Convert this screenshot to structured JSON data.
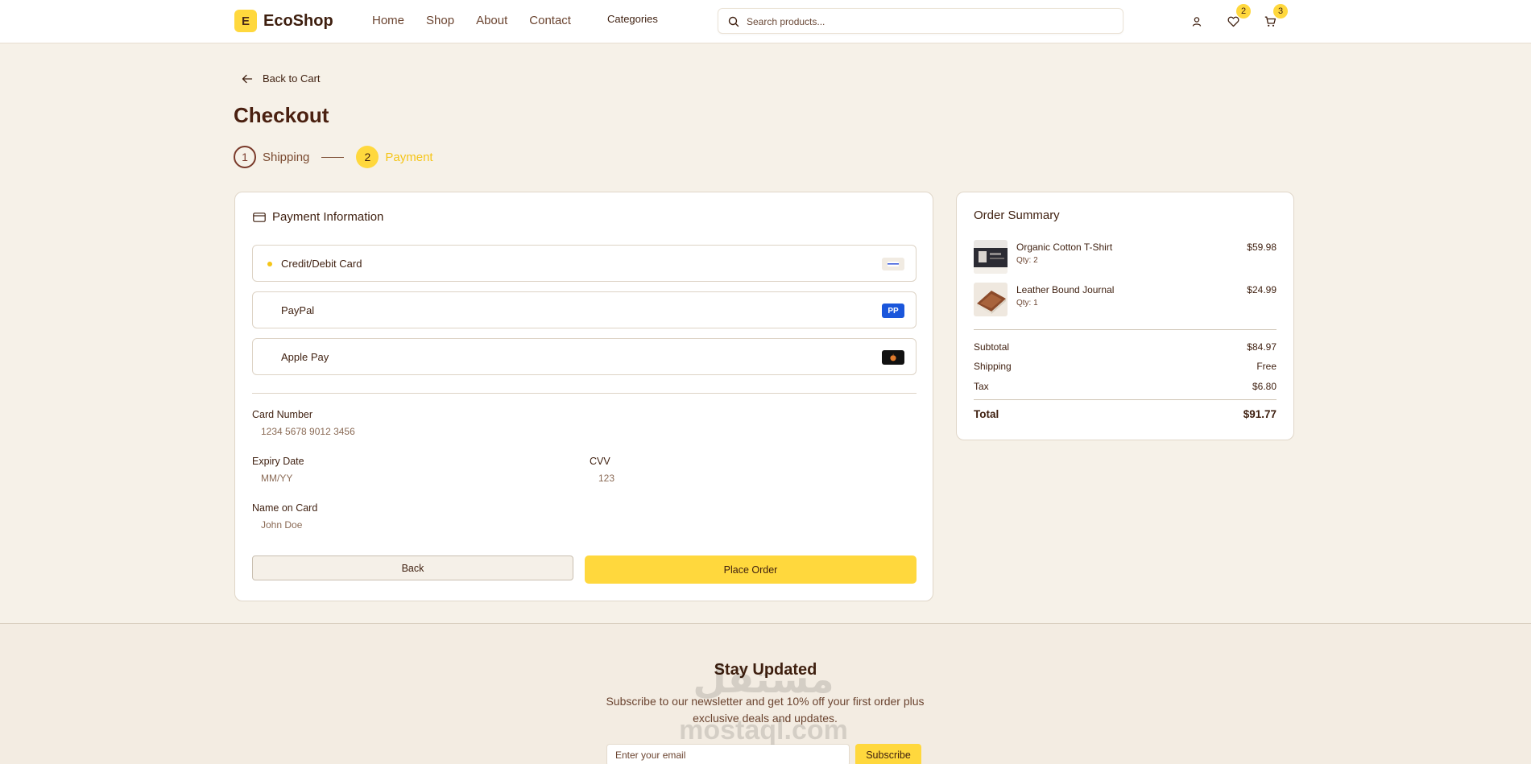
{
  "header": {
    "logo_letter": "E",
    "logo_text": "EcoShop",
    "nav": [
      "Home",
      "Shop",
      "About",
      "Contact"
    ],
    "categories": "Categories",
    "search_placeholder": "Search products...",
    "wishlist_count": "2",
    "cart_count": "3"
  },
  "back_link": "Back to Cart",
  "page_title": "Checkout",
  "stepper": {
    "step1_number": "1",
    "step1_label": "Shipping",
    "step2_number": "2",
    "step2_label": "Payment"
  },
  "payment": {
    "heading": "Payment Information",
    "methods": [
      {
        "label": "Credit/Debit Card",
        "badge": "",
        "selected": true
      },
      {
        "label": "PayPal",
        "badge": "PP",
        "selected": false
      },
      {
        "label": "Apple Pay",
        "badge": "",
        "selected": false
      }
    ],
    "card_number_label": "Card Number",
    "card_number_placeholder": "1234 5678 9012 3456",
    "expiry_label": "Expiry Date",
    "expiry_placeholder": "MM/YY",
    "cvv_label": "CVV",
    "cvv_placeholder": "123",
    "name_label": "Name on Card",
    "name_placeholder": "John Doe",
    "back_button": "Back",
    "place_order_button": "Place Order"
  },
  "summary": {
    "title": "Order Summary",
    "items": [
      {
        "name": "Organic Cotton T-Shirt",
        "qty": "Qty: 2",
        "price": "$59.98"
      },
      {
        "name": "Leather Bound Journal",
        "qty": "Qty: 1",
        "price": "$24.99"
      }
    ],
    "subtotal_label": "Subtotal",
    "subtotal_value": "$84.97",
    "shipping_label": "Shipping",
    "shipping_value": "Free",
    "tax_label": "Tax",
    "tax_value": "$6.80",
    "total_label": "Total",
    "total_value": "$91.77"
  },
  "newsletter": {
    "title": "Stay Updated",
    "text": "Subscribe to our newsletter and get 10% off your first order plus exclusive deals and updates.",
    "email_placeholder": "Enter your email",
    "button": "Subscribe"
  },
  "watermark": {
    "arabic": "مستقل",
    "latin": "mostaql.com"
  },
  "colors": {
    "accent": "#ffd83d",
    "background": "#f6f1e8",
    "text": "#3e1f0f"
  }
}
